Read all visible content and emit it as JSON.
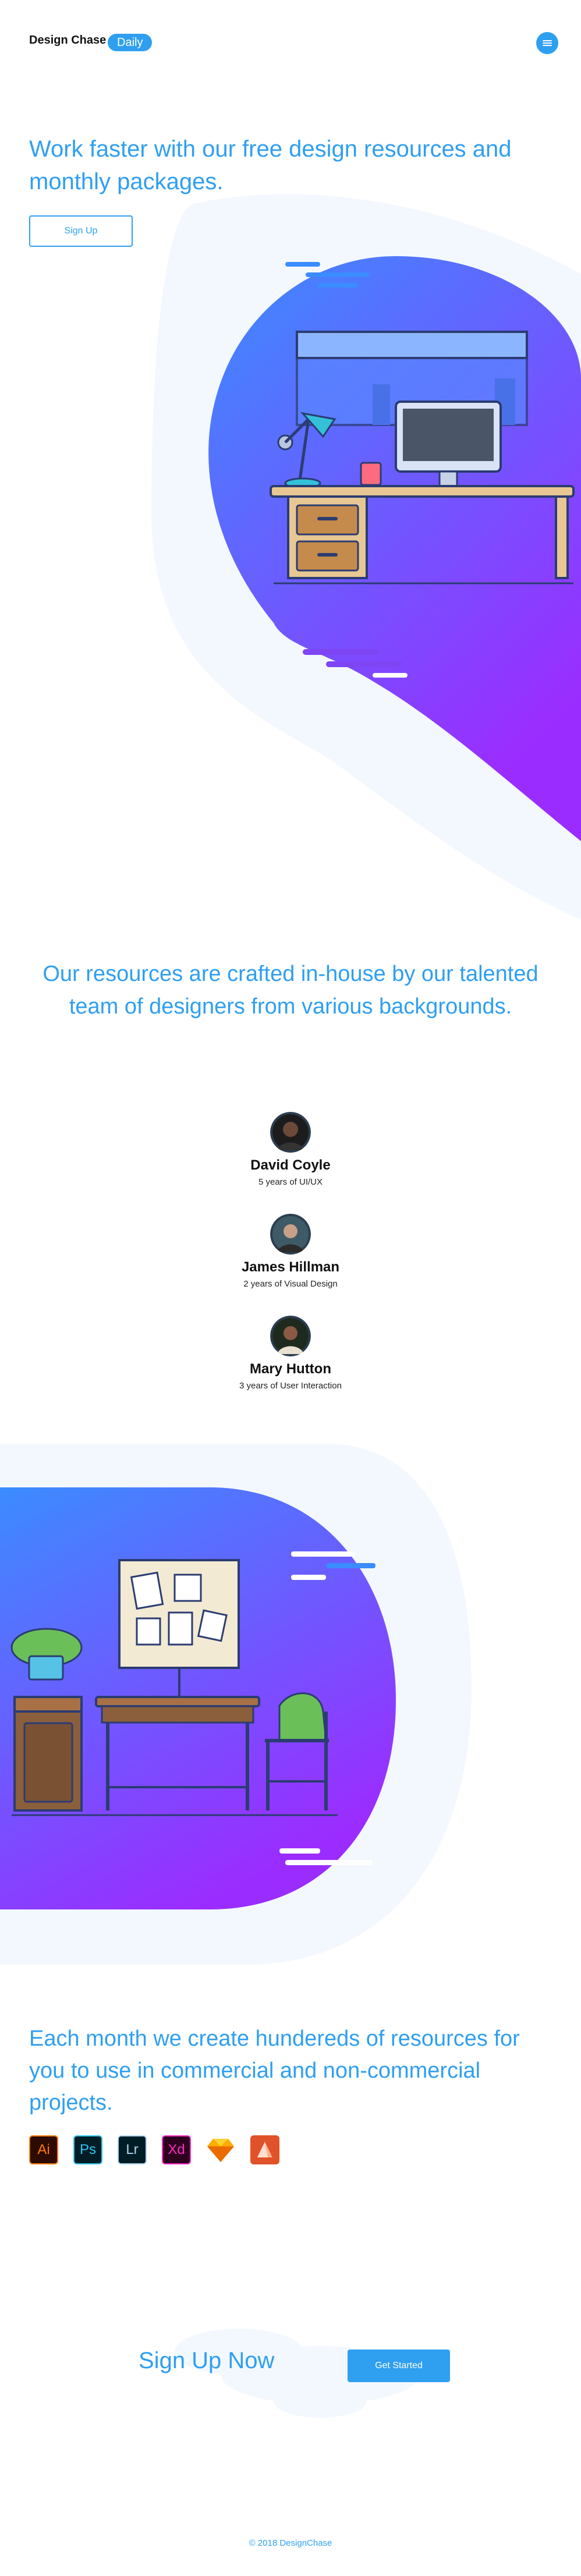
{
  "header": {
    "brand": "Design Chase",
    "badge": "Daily",
    "menu_icon": "hamburger-icon"
  },
  "hero": {
    "title": "Work faster with our free design resources and monthly packages.",
    "cta": "Sign Up"
  },
  "team": {
    "title": "Our resources are crafted in-house by our talented team of designers from various backgrounds.",
    "members": [
      {
        "name": "David Coyle",
        "role": "5 years of UI/UX"
      },
      {
        "name": "James Hillman",
        "role": "2 years of Visual Design"
      },
      {
        "name": "Mary Hutton",
        "role": "3 years of User Interaction"
      }
    ]
  },
  "resources": {
    "title": "Each month we create hundereds of resources for you to use in commercial and non-commercial projects.",
    "apps": [
      {
        "label": "Ai",
        "icon": "illustrator-icon",
        "bg": "#2d0b00",
        "fg": "#ff7c00"
      },
      {
        "label": "Ps",
        "icon": "photoshop-icon",
        "bg": "#001d26",
        "fg": "#31c5f0"
      },
      {
        "label": "Lr",
        "icon": "lightroom-icon",
        "bg": "#001d26",
        "fg": "#add5ec"
      },
      {
        "label": "Xd",
        "icon": "xd-icon",
        "bg": "#2e001f",
        "fg": "#ff2bc2"
      },
      {
        "label": "",
        "icon": "sketch-icon",
        "bg": "#ffffff",
        "fg": "#fdad00"
      },
      {
        "label": "",
        "icon": "affinity-icon",
        "bg": "#ffffff",
        "fg": "#e0532a"
      }
    ]
  },
  "signup": {
    "title": "Sign Up Now",
    "cta": "Get Started"
  },
  "footer": {
    "text": "© 2018 DesignChase"
  },
  "colors": {
    "accent": "#2f9ff0",
    "gradient_start": "#3b8cff",
    "gradient_end": "#9b2cff",
    "pale": "#f3f8fe"
  }
}
